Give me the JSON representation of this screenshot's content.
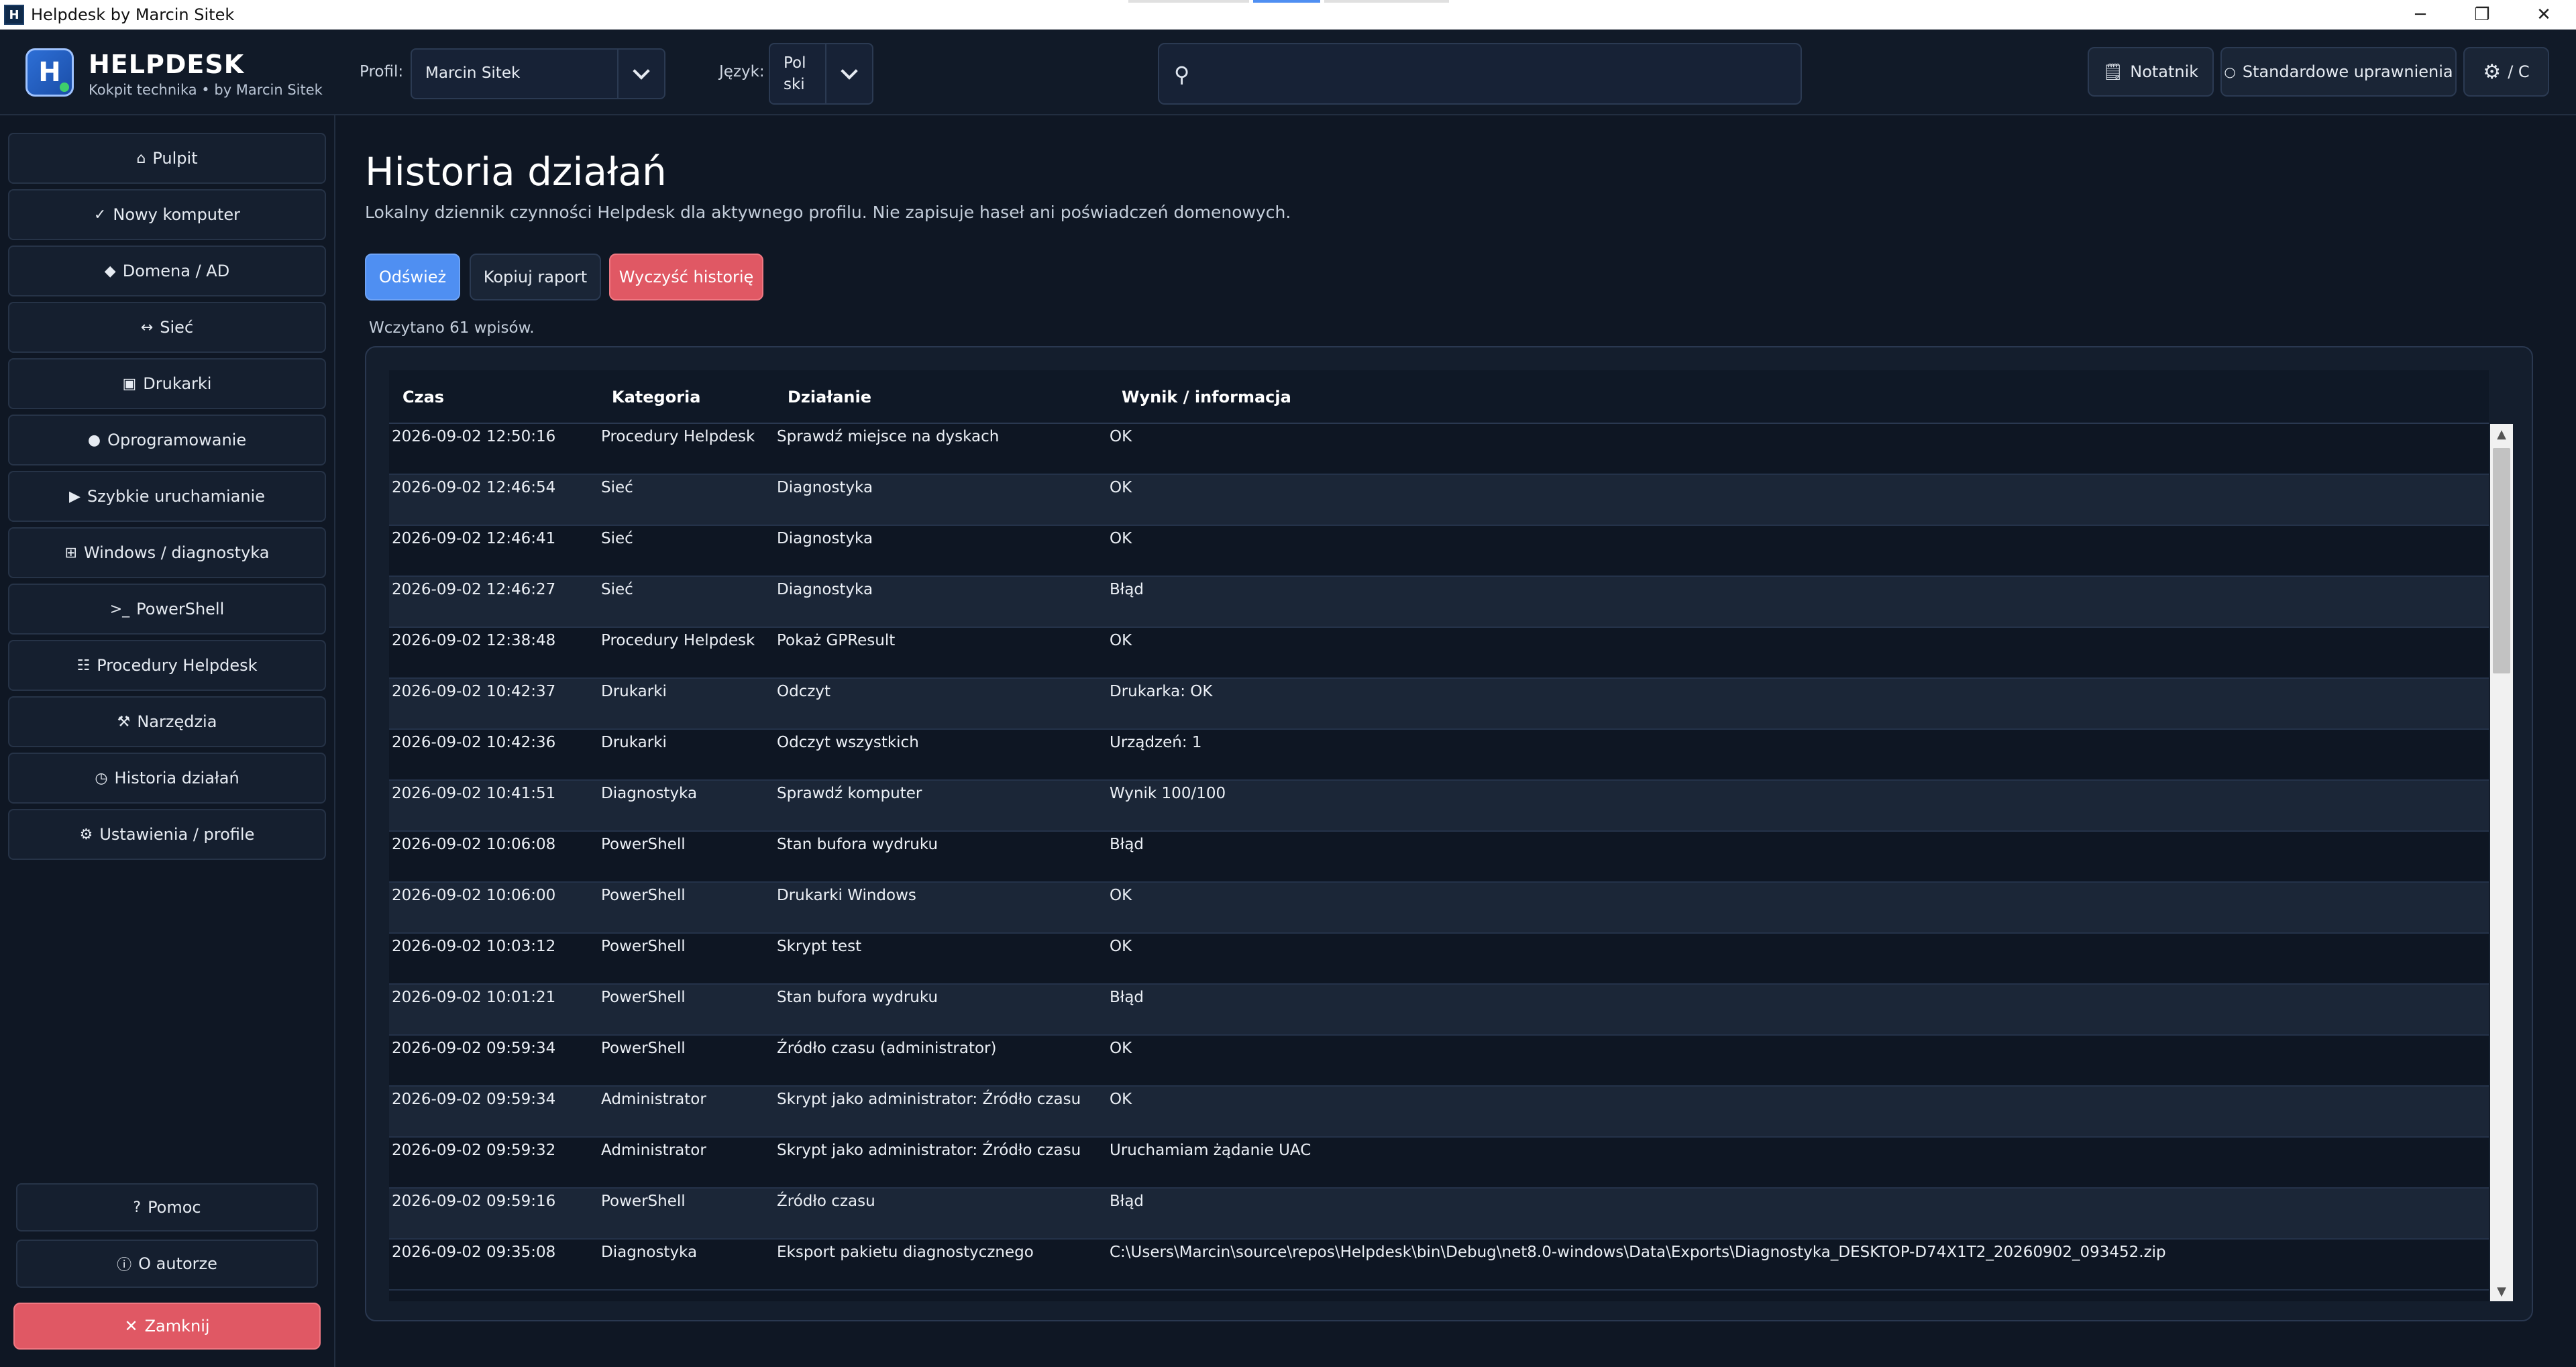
{
  "window": {
    "title": "Helpdesk by Marcin Sitek",
    "icon_text": "H",
    "controls": {
      "minimize": "─",
      "restore": "❐",
      "close": "✕"
    }
  },
  "header": {
    "logo_text": "H",
    "brand": "HELPDESK",
    "brand_sub": "Kokpit technika • by Marcin Sitek",
    "profile_label": "Profil:",
    "profile_value": "Marcin Sitek",
    "language_label": "Język:",
    "language_value_line1": "Pol",
    "language_value_line2": "ski",
    "search_placeholder": "",
    "notebook_label": "Notatnik",
    "permissions_label": "Standardowe uprawnienia",
    "settings_label": "/ C"
  },
  "sidebar": {
    "items": [
      {
        "icon": "⌂",
        "label": "Pulpit"
      },
      {
        "icon": "✓",
        "label": "Nowy komputer"
      },
      {
        "icon": "◆",
        "label": "Domena / AD"
      },
      {
        "icon": "↔",
        "label": "Sieć"
      },
      {
        "icon": "▣",
        "label": "Drukarki"
      },
      {
        "icon": "●",
        "label": "Oprogramowanie"
      },
      {
        "icon": "▶",
        "label": "Szybkie uruchamianie"
      },
      {
        "icon": "⊞",
        "label": "Windows / diagnostyka"
      },
      {
        "icon": ">_",
        "label": "PowerShell"
      },
      {
        "icon": "☷",
        "label": "Procedury Helpdesk"
      },
      {
        "icon": "⚒",
        "label": "Narzędzia"
      },
      {
        "icon": "◷",
        "label": "Historia działań"
      },
      {
        "icon": "⚙",
        "label": "Ustawienia / profile"
      }
    ],
    "help_label": "Pomoc",
    "author_label": "O autorze",
    "close_label": "Zamknij"
  },
  "main": {
    "title": "Historia działań",
    "subtitle": "Lokalny dziennik czynności Helpdesk dla aktywnego profilu. Nie zapisuje haseł ani poświadczeń domenowych.",
    "refresh_label": "Odśwież",
    "copy_label": "Kopiuj raport",
    "clear_label": "Wyczyść historię",
    "count_text": "Wczytano 61 wpisów.",
    "columns": [
      "Czas",
      "Kategoria",
      "Działanie",
      "Wynik / informacja"
    ],
    "rows": [
      [
        "2026-09-02 12:50:16",
        "Procedury Helpdesk",
        "Sprawdź miejsce na dyskach",
        "OK"
      ],
      [
        "2026-09-02 12:46:54",
        "Sieć",
        "Diagnostyka",
        "OK"
      ],
      [
        "2026-09-02 12:46:41",
        "Sieć",
        "Diagnostyka",
        "OK"
      ],
      [
        "2026-09-02 12:46:27",
        "Sieć",
        "Diagnostyka",
        "Błąd"
      ],
      [
        "2026-09-02 12:38:48",
        "Procedury Helpdesk",
        "Pokaż GPResult",
        "OK"
      ],
      [
        "2026-09-02 10:42:37",
        "Drukarki",
        "Odczyt",
        "Drukarka: OK"
      ],
      [
        "2026-09-02 10:42:36",
        "Drukarki",
        "Odczyt wszystkich",
        "Urządzeń: 1"
      ],
      [
        "2026-09-02 10:41:51",
        "Diagnostyka",
        "Sprawdź komputer",
        "Wynik 100/100"
      ],
      [
        "2026-09-02 10:06:08",
        "PowerShell",
        "Stan bufora wydruku",
        "Błąd"
      ],
      [
        "2026-09-02 10:06:00",
        "PowerShell",
        "Drukarki Windows",
        "OK"
      ],
      [
        "2026-09-02 10:03:12",
        "PowerShell",
        "Skrypt test",
        "OK"
      ],
      [
        "2026-09-02 10:01:21",
        "PowerShell",
        "Stan bufora wydruku",
        "Błąd"
      ],
      [
        "2026-09-02 09:59:34",
        "PowerShell",
        "Źródło czasu (administrator)",
        "OK"
      ],
      [
        "2026-09-02 09:59:34",
        "Administrator",
        "Skrypt jako administrator: Źródło czasu",
        "OK"
      ],
      [
        "2026-09-02 09:59:32",
        "Administrator",
        "Skrypt jako administrator: Źródło czasu",
        "Uruchamiam żądanie UAC"
      ],
      [
        "2026-09-02 09:59:16",
        "PowerShell",
        "Źródło czasu",
        "Błąd"
      ],
      [
        "2026-09-02 09:35:08",
        "Diagnostyka",
        "Eksport pakietu diagnostycznego",
        "C:\\Users\\Marcin\\source\\repos\\Helpdesk\\bin\\Debug\\net8.0-windows\\Data\\Exports\\Diagnostyka_DESKTOP-D74X1T2_20260902_093452.zip"
      ]
    ]
  },
  "colors": {
    "background": "#0f1724",
    "primary": "#4f8ff2",
    "danger": "#e05864"
  }
}
